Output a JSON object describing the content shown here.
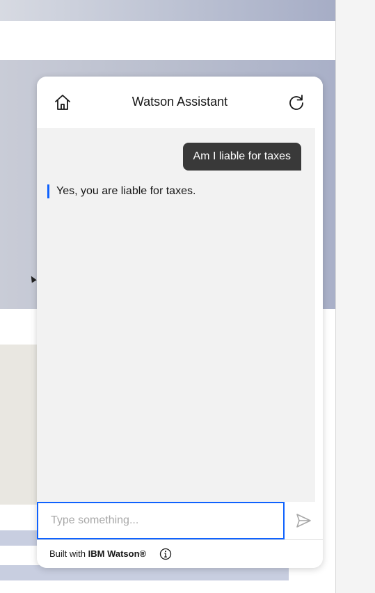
{
  "chat": {
    "title": "Watson Assistant",
    "user_message": "Am I liable for taxes",
    "bot_message": "Yes, you are liable for taxes.",
    "help_label": "?",
    "input_placeholder": "Type something...",
    "footer_prefix": "Built with ",
    "footer_brand": "IBM Watson®"
  },
  "icons": {
    "home": "home-icon",
    "restart": "restart-icon",
    "send": "send-icon",
    "info": "info-icon",
    "help": "help-icon"
  },
  "colors": {
    "accent": "#0f62fe",
    "user_bubble": "#393939",
    "chat_background": "#f2f2f2"
  }
}
